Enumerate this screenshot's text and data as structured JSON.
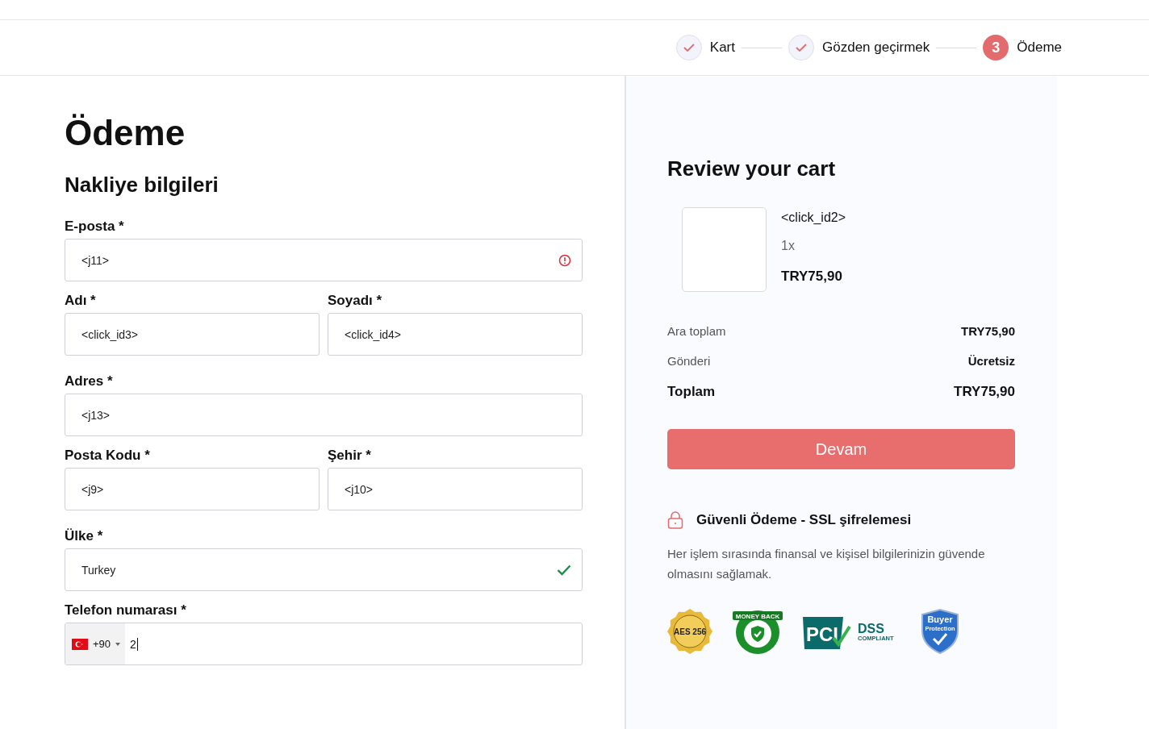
{
  "steps": [
    {
      "label": "Kart",
      "done": true
    },
    {
      "label": "Gözden geçirmek",
      "done": true
    },
    {
      "label": "Ödeme",
      "done": false,
      "number": "3"
    }
  ],
  "page_title": "Ödeme",
  "section_title": "Nakliye bilgileri",
  "field_rows": [
    [
      {
        "label": "E-posta *",
        "value": "<j11>",
        "error": true,
        "valid": false
      }
    ],
    [
      {
        "label": "Adı *",
        "value": "<click_id3>",
        "error": false,
        "valid": false
      },
      {
        "label": "Soyadı *",
        "value": "<click_id4>",
        "error": false,
        "valid": false
      }
    ],
    [
      {
        "label": "Adres *",
        "value": "<j13>",
        "error": false,
        "valid": false
      }
    ],
    [
      {
        "label": "Posta Kodu *",
        "value": "<j9>",
        "error": false,
        "valid": false
      },
      {
        "label": "Şehir *",
        "value": "<j10>",
        "error": false,
        "valid": false
      }
    ],
    [
      {
        "label": "Ülke *",
        "value": "Turkey",
        "error": false,
        "valid": true
      }
    ]
  ],
  "phone": {
    "label": "Telefon numarası *",
    "dial_code": "+90",
    "value": "2"
  },
  "cart": {
    "title": "Review your cart",
    "item": {
      "name": "<click_id2>",
      "quantity": "1x",
      "price": "TRY75,90"
    },
    "summary": [
      {
        "label": "Ara toplam",
        "value": "TRY75,90",
        "bold": false
      },
      {
        "label": "Gönderi",
        "value": "Ücretsiz",
        "bold": false
      },
      {
        "label": "Toplam",
        "value": "TRY75,90",
        "bold": true
      }
    ],
    "button": "Devam",
    "secure_title": "Güvenli Ödeme - SSL şifrelemesi",
    "secure_text": "Her işlem sırasında finansal ve kişisel bilgilerinizin güvende olmasını sağlamak.",
    "badges": [
      {
        "kind": "aes",
        "texts": [
          "AES 256"
        ]
      },
      {
        "kind": "money",
        "texts": [
          "MONEY BACK"
        ]
      },
      {
        "kind": "pci",
        "texts": [
          "PCI",
          "DSS",
          "COMPLIANT"
        ]
      },
      {
        "kind": "buyer",
        "texts": [
          "Buyer",
          "Protection"
        ]
      }
    ]
  }
}
